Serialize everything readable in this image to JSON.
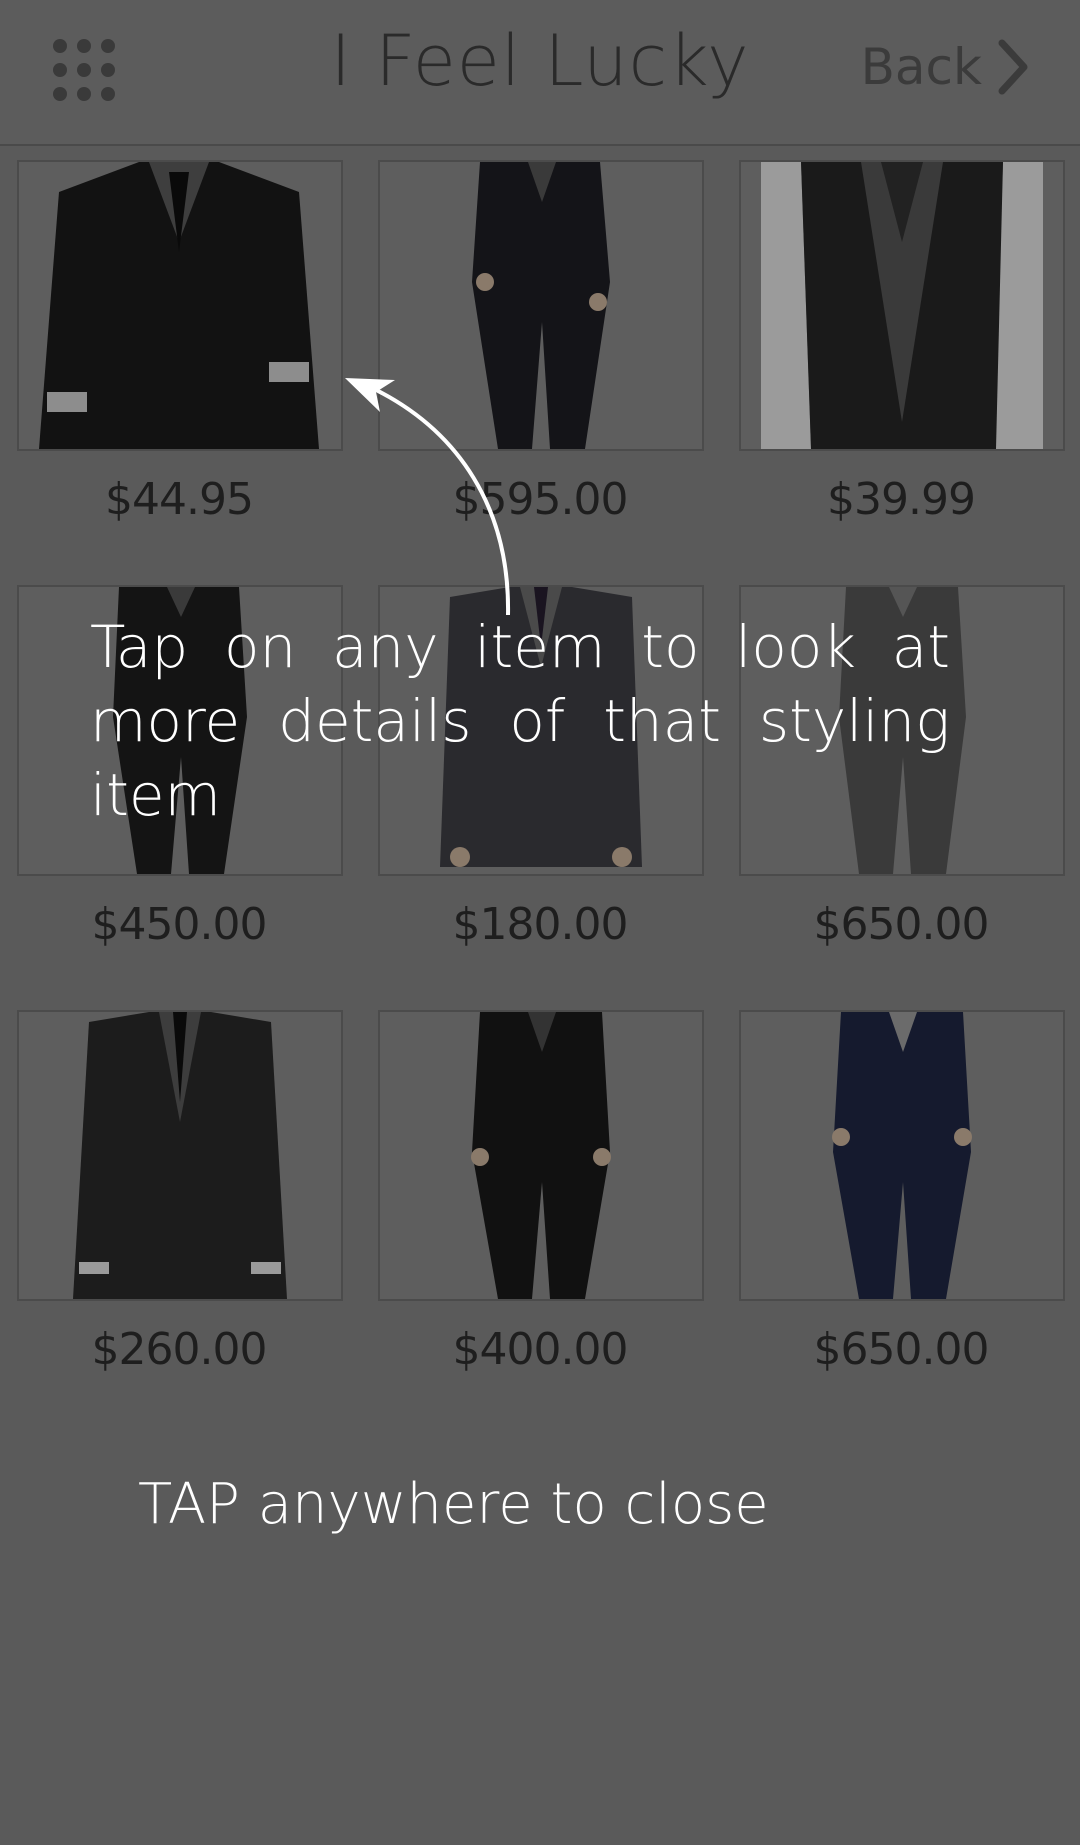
{
  "header": {
    "title": "I Feel Lucky",
    "back_label": "Back",
    "menu_icon": "grid-menu-icon",
    "back_icon": "chevron-right-icon"
  },
  "products": [
    {
      "price": "$44.95"
    },
    {
      "price": "$595.00"
    },
    {
      "price": "$39.99"
    },
    {
      "price": "$450.00"
    },
    {
      "price": "$180.00"
    },
    {
      "price": "$650.00"
    },
    {
      "price": "$260.00"
    },
    {
      "price": "$400.00"
    },
    {
      "price": "$650.00"
    }
  ],
  "overlay": {
    "tip_text": "Tap on any item to look at more details of that styling item",
    "close_hint": "TAP anywhere to close",
    "arrow_icon": "curved-arrow-icon"
  },
  "colors": {
    "overlay_bg": "#5a5a5a",
    "overlay_text": "#ffffff"
  }
}
